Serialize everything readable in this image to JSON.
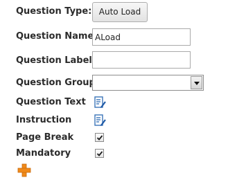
{
  "form": {
    "question_type": {
      "label": "Question Type:",
      "button_label": "Auto Load"
    },
    "question_name": {
      "label": "Question Name",
      "value": "ALoad"
    },
    "question_label": {
      "label": "Question Label",
      "value": ""
    },
    "question_group": {
      "label": "Question Group:",
      "selected": ""
    },
    "question_text": {
      "label": "Question Text",
      "icon": "edit-text-icon"
    },
    "instruction": {
      "label": "Instruction",
      "icon": "edit-text-icon"
    },
    "page_break": {
      "label": "Page Break",
      "checked": true
    },
    "mandatory": {
      "label": "Mandatory",
      "checked": true
    },
    "add": {
      "icon": "add-icon"
    }
  },
  "colors": {
    "label_text": "#2b2b2b",
    "edit_icon": "#3b74b8",
    "add_icon": "#f08a1a"
  }
}
